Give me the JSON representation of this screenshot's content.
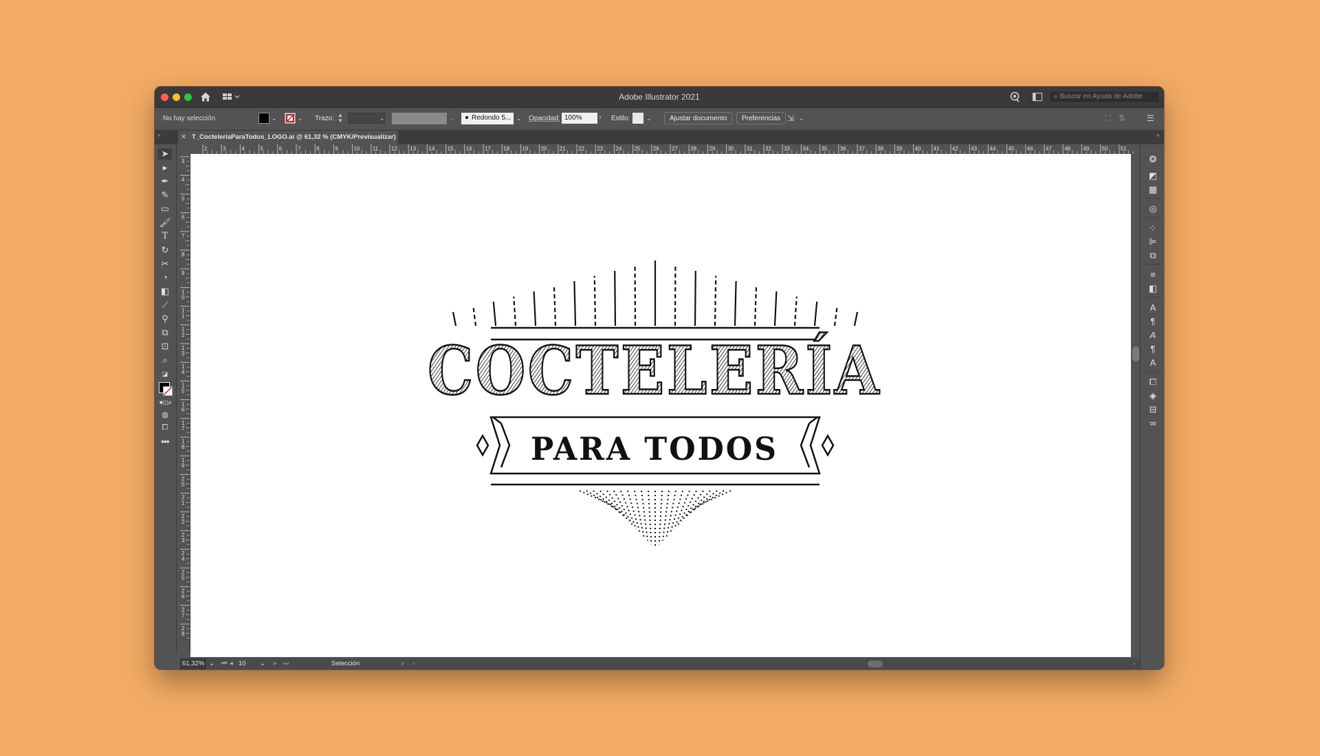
{
  "app": {
    "window_title": "Adobe Illustrator 2021",
    "help_search_placeholder": "Buscar en Ayuda de Adobe"
  },
  "control_bar": {
    "selection_status": "No hay selección",
    "stroke_label": "Trazo:",
    "brush_value": "Redondo 5...",
    "opacity_label": "Opacidad:",
    "opacity_value": "100%",
    "style_label": "Estilo:",
    "fit_document_button": "Ajustar documento",
    "preferences_button": "Preferencias"
  },
  "document_tab": {
    "title": "T_CocteleriaParaTodos_LOGO.ai @ 61,32 % (CMYK/Previsualizar)"
  },
  "rulers": {
    "top": [
      "2",
      "3",
      "4",
      "5",
      "6",
      "7",
      "8",
      "9",
      "10",
      "11",
      "12",
      "13",
      "14",
      "15",
      "16",
      "17",
      "18",
      "19",
      "20",
      "21",
      "22",
      "23",
      "24",
      "25",
      "26",
      "27",
      "28",
      "29",
      "30",
      "31",
      "32",
      "33",
      "34",
      "35",
      "36",
      "37",
      "38",
      "39",
      "40",
      "41",
      "42",
      "43",
      "44",
      "45",
      "46",
      "47",
      "48",
      "49",
      "50",
      "51"
    ],
    "left": [
      "3",
      "4",
      "5",
      "6",
      "7",
      "8",
      "9",
      "1\n0",
      "1\n1",
      "1\n2",
      "1\n3",
      "1\n4",
      "1\n5",
      "1\n6",
      "1\n7",
      "1\n8",
      "1\n9",
      "2\n0",
      "2\n1",
      "2\n2",
      "2\n3",
      "2\n4",
      "2\n5",
      "2\n6",
      "2\n7",
      "2\n8"
    ]
  },
  "artwork": {
    "headline": "COCTELERÍA",
    "ribbon_text": "PARA TODOS",
    "ink_color": "#111111"
  },
  "status_bar": {
    "zoom": "61,32%",
    "artboard_number": "10",
    "current_tool": "Selección"
  },
  "colors": {
    "background": "#f2aa64",
    "ui_dark": "#535353",
    "titlebar": "#3a3a3a"
  }
}
